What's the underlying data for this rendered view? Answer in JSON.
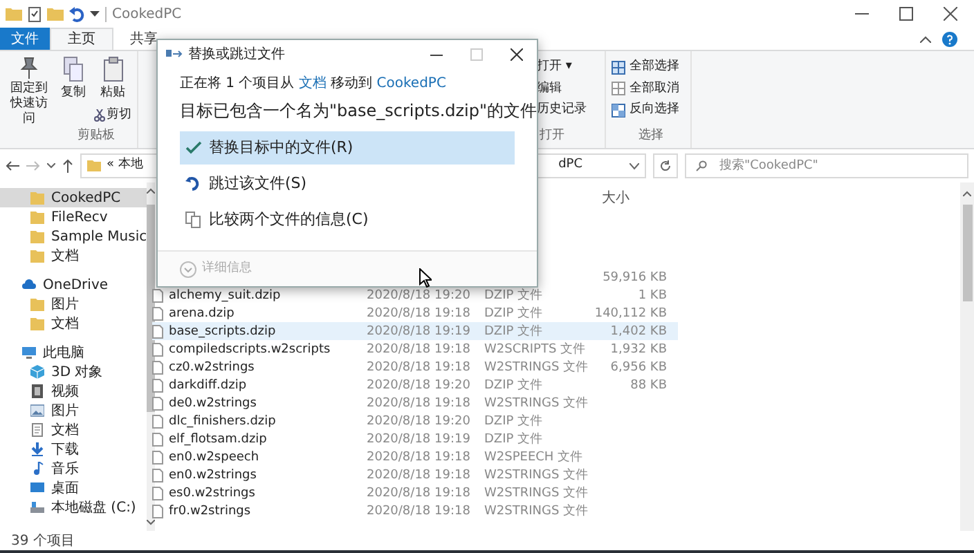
{
  "window": {
    "title": "CookedPC"
  },
  "ribbon_tabs": [
    {
      "label": "文件",
      "kind": "file",
      "selected": false
    },
    {
      "label": "主页",
      "kind": "tab",
      "selected": true
    },
    {
      "label": "共享",
      "kind": "tab",
      "selected": false
    }
  ],
  "clipboard_group": {
    "pin": "固定到快速访问",
    "copy": "复制",
    "paste": "粘贴",
    "cut": "剪切",
    "label": "剪贴板"
  },
  "open_group": {
    "items": [
      {
        "label": "打开 ▾"
      },
      {
        "label": "编辑"
      },
      {
        "label": "历史记录"
      }
    ],
    "label": "打开"
  },
  "select_group": {
    "items": [
      {
        "label": "全部选择",
        "kind": "all"
      },
      {
        "label": "全部取消",
        "kind": "none"
      },
      {
        "label": "反向选择",
        "kind": "invert"
      }
    ],
    "label": "选择"
  },
  "address": {
    "path_start": "« 本地",
    "path_end": "dPC"
  },
  "search": {
    "placeholder": "搜索\"CookedPC\""
  },
  "nav": [
    {
      "label": "CookedPC",
      "kind": "folder",
      "selected": true
    },
    {
      "label": "FileRecv",
      "kind": "folder",
      "selected": false
    },
    {
      "label": "Sample Music",
      "kind": "folder",
      "selected": false
    },
    {
      "label": "文档",
      "kind": "folder",
      "selected": false
    },
    {
      "label": "OneDrive",
      "kind": "cloud",
      "selected": false,
      "children": [
        {
          "label": "图片",
          "kind": "folder",
          "selected": false
        },
        {
          "label": "文档",
          "kind": "folder",
          "selected": false
        }
      ]
    },
    {
      "label": "此电脑",
      "kind": "pc",
      "selected": false,
      "children": [
        {
          "label": "3D 对象",
          "kind": "cube",
          "selected": false
        },
        {
          "label": "视频",
          "kind": "video",
          "selected": false
        },
        {
          "label": "图片",
          "kind": "picture",
          "selected": false
        },
        {
          "label": "文档",
          "kind": "doc",
          "selected": false
        },
        {
          "label": "下载",
          "kind": "download",
          "selected": false
        },
        {
          "label": "音乐",
          "kind": "music",
          "selected": false
        },
        {
          "label": "桌面",
          "kind": "desktop",
          "selected": false
        },
        {
          "label": "本地磁盘 (C:)",
          "kind": "disk",
          "selected": false
        }
      ]
    }
  ],
  "columns": [
    {
      "label": "大小"
    }
  ],
  "files": [
    {
      "size": "59,916 KB",
      "selected": false
    },
    {
      "name": "alchemy_suit.dzip",
      "date": "2020/8/18 19:20",
      "type": "DZIP 文件",
      "size": "1 KB",
      "selected": false
    },
    {
      "name": "arena.dzip",
      "date": "2020/8/18 19:18",
      "type": "DZIP 文件",
      "size": "140,112 KB",
      "selected": false
    },
    {
      "name": "base_scripts.dzip",
      "date": "2020/8/18 19:19",
      "type": "DZIP 文件",
      "size": "1,402 KB",
      "selected": true
    },
    {
      "name": "compiledscripts.w2scripts",
      "date": "2020/8/18 19:18",
      "type": "W2SCRIPTS 文件",
      "size": "1,932 KB",
      "selected": false
    },
    {
      "name": "cz0.w2strings",
      "date": "2020/8/18 19:18",
      "type": "W2STRINGS 文件",
      "size": "6,956 KB",
      "selected": false
    },
    {
      "name": "darkdiff.dzip",
      "date": "2020/8/18 19:20",
      "type": "DZIP 文件",
      "size": "88 KB",
      "selected": false
    },
    {
      "name": "de0.w2strings",
      "date": "2020/8/18 19:18",
      "type": "W2STRINGS 文件",
      "selected": false
    },
    {
      "name": "dlc_finishers.dzip",
      "date": "2020/8/18 19:20",
      "type": "DZIP 文件",
      "selected": false
    },
    {
      "name": "elf_flotsam.dzip",
      "date": "2020/8/18 19:19",
      "type": "DZIP 文件",
      "selected": false
    },
    {
      "name": "en0.w2speech",
      "date": "2020/8/18 19:18",
      "type": "W2SPEECH 文件",
      "selected": false
    },
    {
      "name": "en0.w2strings",
      "date": "2020/8/18 19:18",
      "type": "W2STRINGS 文件",
      "selected": false
    },
    {
      "name": "es0.w2strings",
      "date": "2020/8/18 19:18",
      "type": "W2STRINGS 文件",
      "selected": false
    },
    {
      "name": "fr0.w2strings",
      "date": "2020/8/18 19:18",
      "type": "W2STRINGS 文件",
      "selected": false
    }
  ],
  "status_bar": {
    "count": "39 个项目"
  },
  "dialog": {
    "title": "替换或跳过文件",
    "message": [
      {
        "text": "正在将 1 个项目从 ",
        "kind": "text"
      },
      {
        "text": "文档",
        "kind": "link"
      },
      {
        "text": " 移动到 ",
        "kind": "text"
      },
      {
        "text": "CookedPC",
        "kind": "link"
      }
    ],
    "heading": "目标已包含一个名为\"base_scripts.dzip\"的文件",
    "options": [
      {
        "label": "替换目标中的文件(R)",
        "kind": "replace",
        "selected": true
      },
      {
        "label": "跳过该文件(S)",
        "kind": "skip",
        "selected": false
      },
      {
        "label": "比较两个文件的信息(C)",
        "kind": "compare",
        "selected": false
      }
    ],
    "details": "详细信息"
  }
}
